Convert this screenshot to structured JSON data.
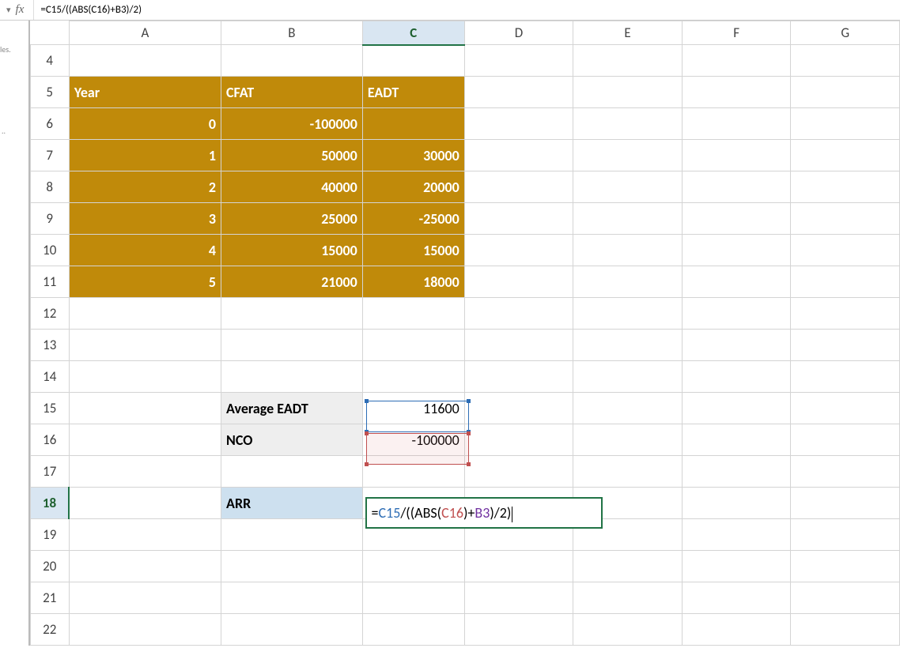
{
  "formula_bar": {
    "fx_label": "fx",
    "value": "=C15/((ABS(C16)+B3)/2)"
  },
  "left_fragment": {
    "text1": "les.",
    "text2": "..",
    "text3": ".."
  },
  "columns": [
    "A",
    "B",
    "C",
    "D",
    "E",
    "F",
    "G"
  ],
  "rows": [
    "4",
    "5",
    "6",
    "7",
    "8",
    "9",
    "10",
    "11",
    "12",
    "13",
    "14",
    "15",
    "16",
    "17",
    "18",
    "19",
    "20",
    "21",
    "22"
  ],
  "active_col": "C",
  "active_row": "18",
  "cells": {
    "A5": "Year",
    "B5": "CFAT",
    "C5": "EADT",
    "A6": "0",
    "B6": "-100000",
    "A7": "1",
    "B7": "50000",
    "C7": "30000",
    "A8": "2",
    "B8": "40000",
    "C8": "20000",
    "A9": "3",
    "B9": "25000",
    "C9": "-25000",
    "A10": "4",
    "B10": "15000",
    "C10": "15000",
    "A11": "5",
    "B11": "21000",
    "C11": "18000",
    "B15": "Average EADT",
    "C15": "11600",
    "B16": "NCO",
    "C16": "-100000",
    "B18": "ARR"
  },
  "editing_formula": {
    "p1": "=",
    "p2": "C15",
    "p3": "/((ABS(",
    "p4": "C16",
    "p5": ")+",
    "p6": "B3",
    "p7": ")/2)"
  },
  "col_widths": {
    "rowhdr": 50,
    "A": 195,
    "B": 180,
    "C": 130,
    "other": 140
  }
}
